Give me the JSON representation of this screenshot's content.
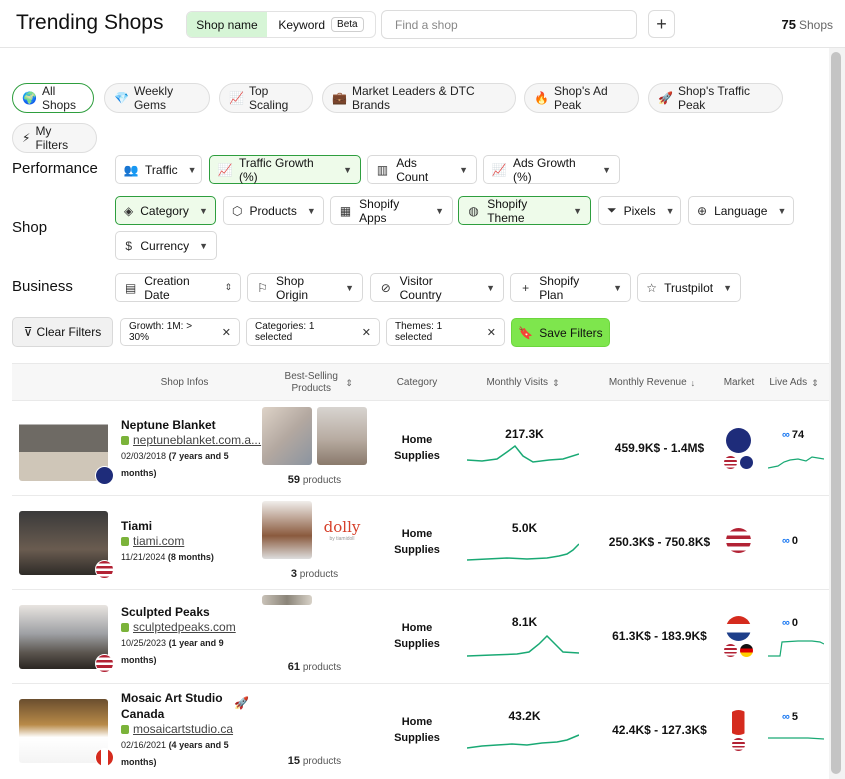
{
  "header": {
    "title": "Trending Shops",
    "toggle_shop_name": "Shop name",
    "toggle_keyword": "Keyword",
    "beta_badge": "Beta",
    "search_placeholder": "Find a shop",
    "add_label": "+",
    "shop_count": "75",
    "shop_count_unit": "Shops"
  },
  "presets": [
    {
      "icon": "🌍",
      "label": "All Shops"
    },
    {
      "icon": "💎",
      "label": "Weekly Gems"
    },
    {
      "icon": "📈",
      "label": "Top Scaling"
    },
    {
      "icon": "💼",
      "label": "Market Leaders & DTC Brands"
    },
    {
      "icon": "🔥",
      "label": "Shop's Ad Peak"
    },
    {
      "icon": "🚀",
      "label": "Shop's Traffic Peak"
    },
    {
      "icon": "⚡",
      "label": "My Filters"
    }
  ],
  "filters": {
    "performance_label": "Performance",
    "shop_label": "Shop",
    "business_label": "Business",
    "performance": [
      "Traffic",
      "Traffic Growth (%)",
      "Ads Count",
      "Ads Growth (%)"
    ],
    "shop": [
      "Category",
      "Products",
      "Shopify Apps",
      "Shopify Theme",
      "Pixels",
      "Language",
      "Currency"
    ],
    "business": [
      "Creation Date",
      "Shop Origin",
      "Visitor Country",
      "Shopify Plan",
      "Trustpilot"
    ]
  },
  "active_filters": {
    "clear_label": "Clear Filters",
    "chips": [
      "Growth: 1M: > 30%",
      "Categories: 1 selected",
      "Themes: 1 selected"
    ],
    "save_label": "Save Filters"
  },
  "table": {
    "columns": [
      "Shop Infos",
      "Best-Selling Products",
      "Category",
      "Monthly Visits",
      "Monthly Revenue",
      "Market",
      "Live Ads"
    ],
    "rows": [
      {
        "name": "Neptune Blanket",
        "url": "neptuneblanket.com.a...",
        "date": "02/03/2018",
        "age": "(7 years and 5 months)",
        "products_count": "59",
        "products_unit": "products",
        "category": "Home Supplies",
        "visits": "217.3K",
        "revenue": "459.9K$ - 1.4M$",
        "ads": "74"
      },
      {
        "name": "Tiami",
        "url": "tiami.com",
        "date": "11/21/2024",
        "age": "(8 months)",
        "products_count": "3",
        "products_unit": "products",
        "product_logo": "dolly",
        "product_logo_sub": "by tiamidoll",
        "category": "Home Supplies",
        "visits": "5.0K",
        "revenue": "250.3K$ - 750.8K$",
        "ads": "0"
      },
      {
        "name": "Sculpted Peaks",
        "url": "sculptedpeaks.com",
        "date": "10/25/2023",
        "age": "(1 year and 9 months)",
        "products_count": "61",
        "products_unit": "products",
        "category": "Home Supplies",
        "visits": "8.1K",
        "revenue": "61.3K$ - 183.9K$",
        "ads": "0"
      },
      {
        "name": "Mosaic Art Studio Canada",
        "url": "mosaicartstudio.ca",
        "date": "02/16/2021",
        "age": "(4 years and 5 months)",
        "products_count": "15",
        "products_unit": "products",
        "category": "Home Supplies",
        "visits": "43.2K",
        "revenue": "42.4K$ - 127.3K$",
        "ads": "5"
      }
    ]
  },
  "meta_icon": "∞",
  "colors": {
    "accent_green": "#2e9e3e",
    "save_green": "#7ee64d",
    "spark": "#19a974",
    "meta_blue": "#1877f2"
  }
}
